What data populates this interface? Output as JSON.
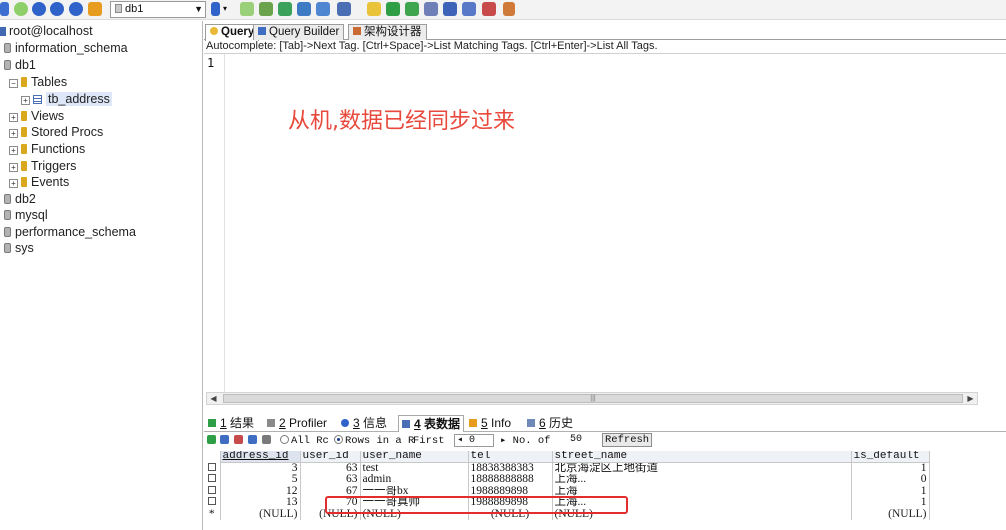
{
  "toolbar": {
    "database_selector_value": "db1",
    "colors": {
      "blue_icon": "#2f63c9",
      "green_icon": "#2e9f46",
      "orange_icon": "#e79b1f"
    }
  },
  "tree": {
    "server": "root@localhost",
    "items": [
      {
        "label": "information_schema"
      },
      {
        "label": "db1"
      },
      {
        "label": "Tables"
      },
      {
        "label": "tb_address"
      },
      {
        "label": "Views"
      },
      {
        "label": "Stored Procs"
      },
      {
        "label": "Functions"
      },
      {
        "label": "Triggers"
      },
      {
        "label": "Events"
      },
      {
        "label": "db2"
      },
      {
        "label": "mysql"
      },
      {
        "label": "performance_schema"
      },
      {
        "label": "sys"
      }
    ]
  },
  "editor_tabs": [
    "Query",
    "Query Builder",
    "架构设计器"
  ],
  "autocomplete_hint": "Autocomplete: [Tab]->Next Tag. [Ctrl+Space]->List Matching Tags. [Ctrl+Enter]->List All Tags.",
  "editor": {
    "line_number": "1",
    "annotation": "从机,数据已经同步过来",
    "annotation_color": "#e8493c"
  },
  "result_tabs": [
    {
      "num": "1",
      "label": "结果"
    },
    {
      "num": "2",
      "label": "Profiler"
    },
    {
      "num": "3",
      "label": "信息"
    },
    {
      "num": "4",
      "label": "表数据"
    },
    {
      "num": "5",
      "label": "Info"
    },
    {
      "num": "6",
      "label": "历史"
    }
  ],
  "result_toolbar": {
    "all_rows": "All Rc",
    "rows_in_range": "Rows in a R",
    "first_label": "First",
    "first_value": "0",
    "no_of_label": "No. of",
    "no_of_value": "50",
    "refresh": "Refresh"
  },
  "grid": {
    "columns": [
      "address_id",
      "user_id",
      "user_name",
      "tel",
      "street_name",
      "is_default"
    ],
    "rows": [
      [
        "3",
        "63",
        "test",
        "18838388383",
        "北京海淀区上地街道",
        "1"
      ],
      [
        "5",
        "63",
        "admin",
        "18888888888",
        "上海...",
        "0"
      ],
      [
        "12",
        "67",
        "一一哥bx",
        "1988889898",
        "上海",
        "1"
      ],
      [
        "13",
        "70",
        "一一哥真帅",
        "1988889898",
        "上海...",
        "1"
      ]
    ],
    "new_row_marker": "*",
    "null_text": "(NULL)",
    "highlight_color": "#e12d2d"
  }
}
